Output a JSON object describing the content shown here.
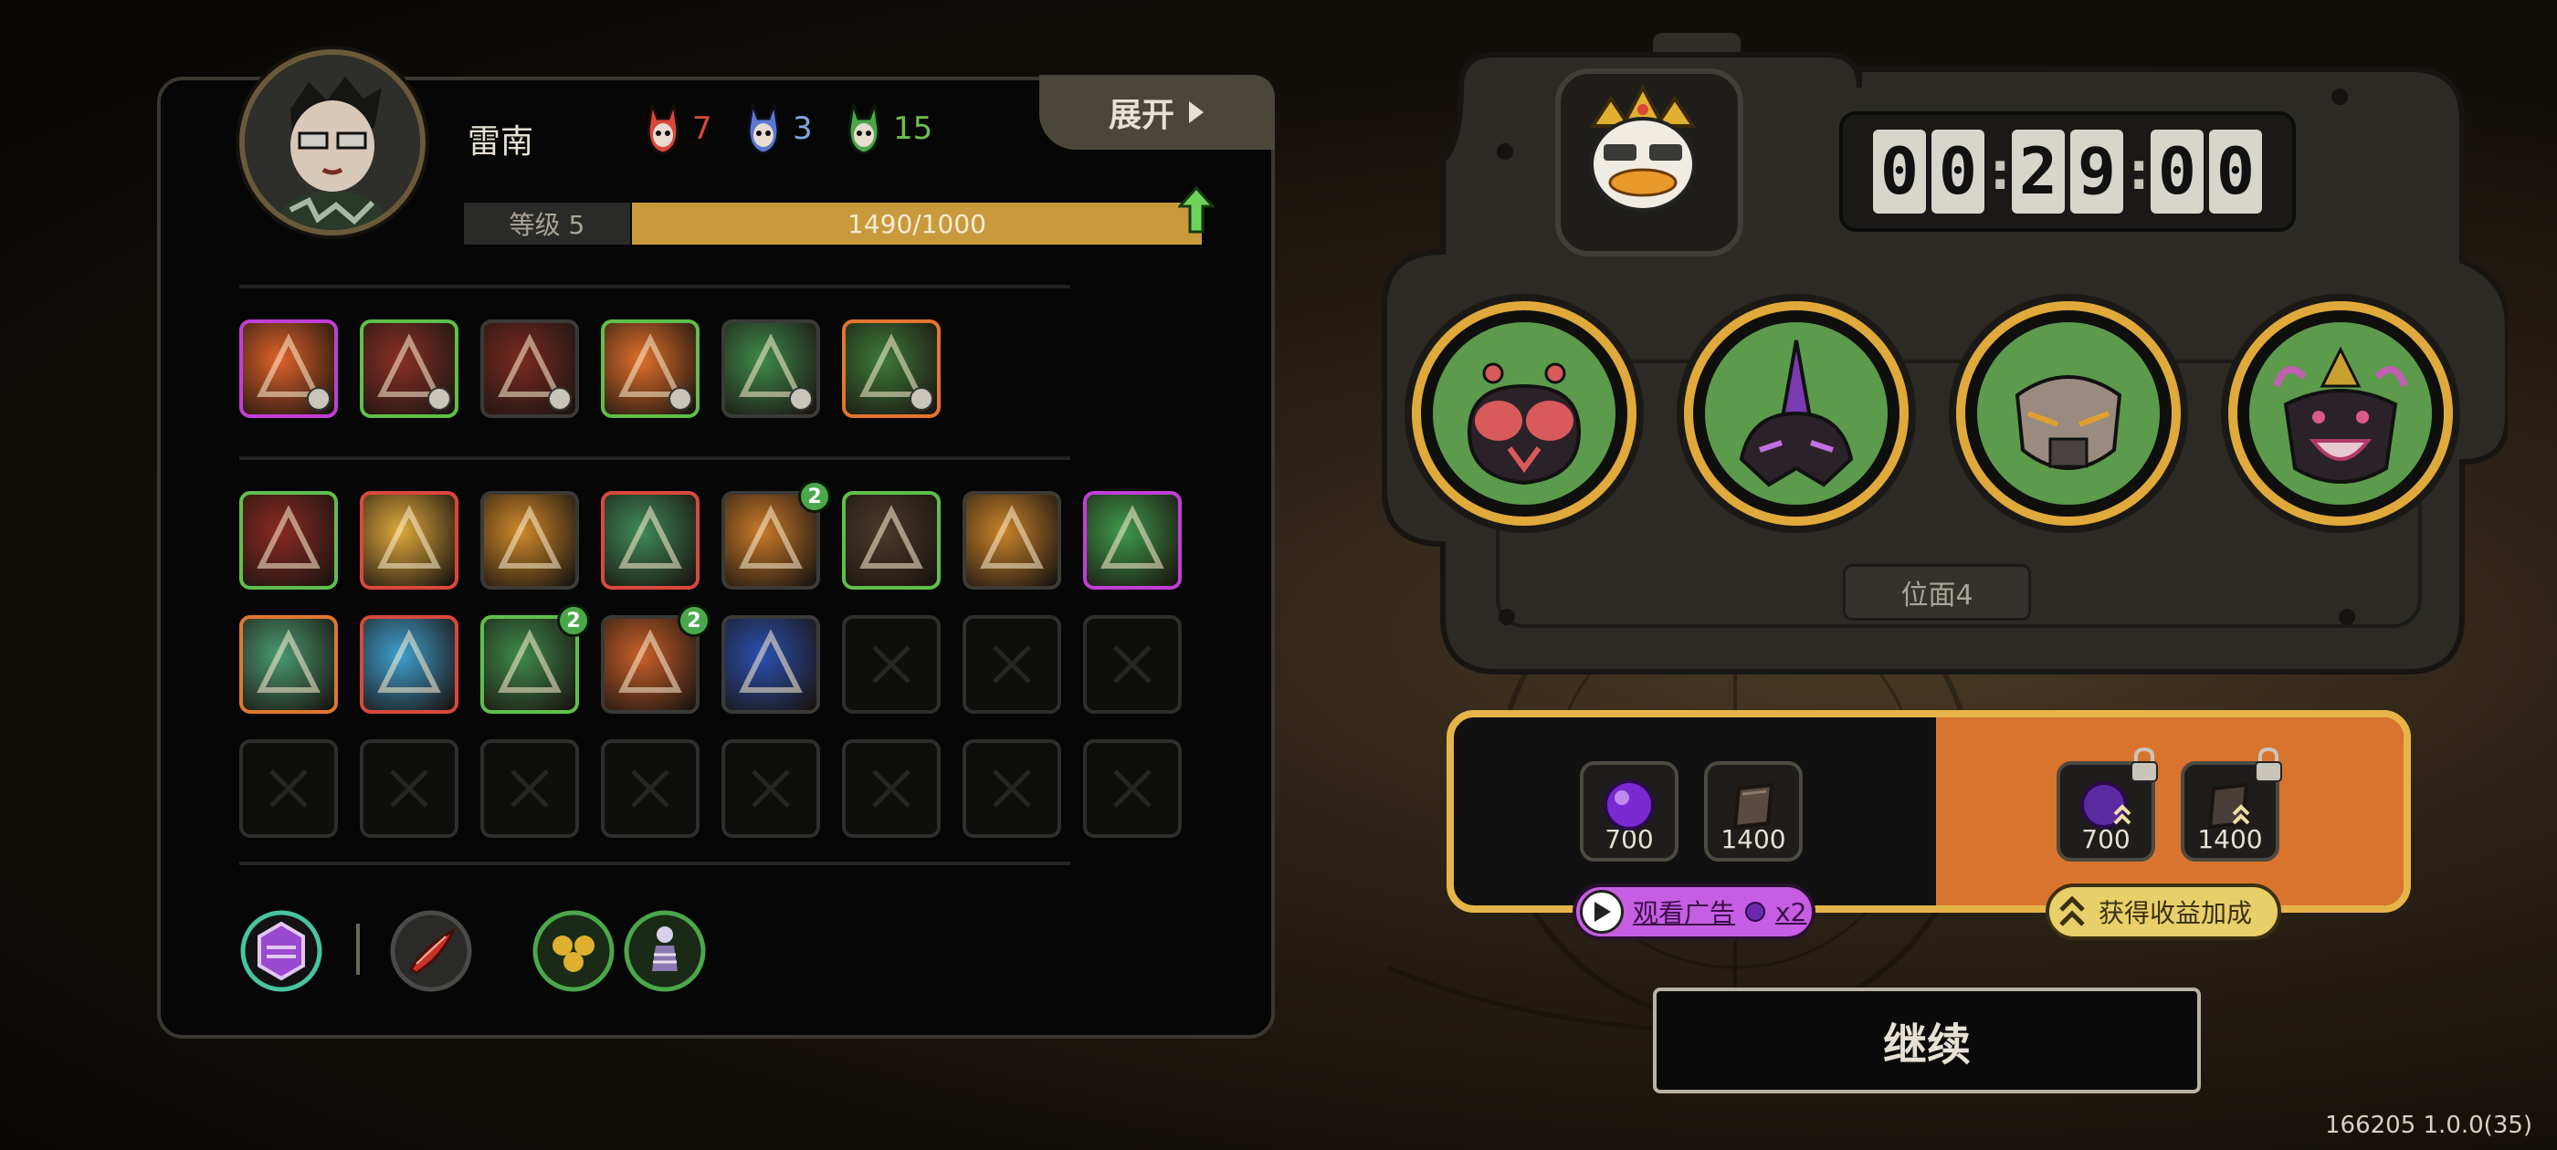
{
  "player": {
    "name": "雷南",
    "level_label": "等级 5",
    "exp_text": "1490/1000",
    "exp_fraction": 1.0,
    "masks": [
      {
        "name": "red-mask",
        "count": "7",
        "color": "#d9483b"
      },
      {
        "name": "blue-mask",
        "count": "3",
        "color": "#7fa6e0"
      },
      {
        "name": "green-mask",
        "count": "15",
        "color": "#6cc04a"
      }
    ]
  },
  "expand_button": {
    "label": "展开"
  },
  "equipped_skills": [
    {
      "name": "burst-skill",
      "border": "#c13ed6",
      "bg": "#e0622a"
    },
    {
      "name": "disc-skill",
      "border": "#5fbf4a",
      "bg": "#8a3028"
    },
    {
      "name": "claw-skill",
      "border": "#3a3a36",
      "bg": "#7a2a22"
    },
    {
      "name": "flame-skill",
      "border": "#5fbf4a",
      "bg": "#e0702a"
    },
    {
      "name": "crystal-skill",
      "border": "#3a3a36",
      "bg": "#3f8a4c"
    },
    {
      "name": "heart-skill",
      "border": "#e2762e",
      "bg": "#3e7a3a"
    }
  ],
  "inventory": [
    {
      "name": "slash-relic",
      "border": "#5fbf4a",
      "bg": "#8a2a24",
      "badge": ""
    },
    {
      "name": "spike-relic",
      "border": "#d9483b",
      "bg": "#e0a93c",
      "badge": ""
    },
    {
      "name": "sun-relic",
      "border": "#3a3a36",
      "bg": "#d08a2a",
      "badge": ""
    },
    {
      "name": "blade-relic",
      "border": "#d9483b",
      "bg": "#3f8a58",
      "badge": ""
    },
    {
      "name": "bolt-relic",
      "border": "#3a3a36",
      "bg": "#c97a2a",
      "badge": "2"
    },
    {
      "name": "beast-relic",
      "border": "#5fbf4a",
      "bg": "#4a3a2a",
      "badge": ""
    },
    {
      "name": "cog-relic",
      "border": "#3a3a36",
      "bg": "#c9832a",
      "badge": ""
    },
    {
      "name": "wind-relic",
      "border": "#c13ed6",
      "bg": "#3f9a4c",
      "badge": ""
    },
    {
      "name": "chain-relic",
      "border": "#e2762e",
      "bg": "#4a9a72",
      "badge": ""
    },
    {
      "name": "star-relic",
      "border": "#d9483b",
      "bg": "#3fa0d0",
      "badge": ""
    },
    {
      "name": "leaf-relic",
      "border": "#5fbf4a",
      "bg": "#3f8a4c",
      "badge": "2"
    },
    {
      "name": "wing-relic",
      "border": "#3a3a36",
      "bg": "#c9602a",
      "badge": "2"
    },
    {
      "name": "storm-relic",
      "border": "#3a3a36",
      "bg": "#2a50b0",
      "badge": ""
    }
  ],
  "empty_slot_count": 11,
  "bottom_icons": [
    {
      "name": "purple-gem-icon",
      "ring": "#47c4a0",
      "fill": "#9a4ad0"
    },
    {
      "name": "red-feather-icon",
      "ring": "#4a4a46",
      "fill": "#c9322a"
    },
    {
      "name": "golden-orbs-icon",
      "ring": "#4aa84a",
      "fill": "#e0b030"
    },
    {
      "name": "pawn-icon",
      "ring": "#4aa84a",
      "fill": "#8a7ab0"
    }
  ],
  "timer": {
    "digits": [
      "0",
      "0",
      "2",
      "9",
      "0",
      "0"
    ]
  },
  "plane_label": "位面4",
  "bosses": [
    {
      "name": "fly-boss",
      "color": "#d95a5a"
    },
    {
      "name": "horn-boss",
      "color": "#7a3ab0"
    },
    {
      "name": "mecha-boss",
      "color": "#9a8a80"
    },
    {
      "name": "jaw-boss",
      "color": "#b03a6a"
    }
  ],
  "rewards": {
    "free": [
      {
        "name": "purple-orb-reward",
        "amount": "700"
      },
      {
        "name": "book-reward",
        "amount": "1400"
      }
    ],
    "bonus": [
      {
        "name": "purple-orb-bonus",
        "amount": "700"
      },
      {
        "name": "book-bonus",
        "amount": "1400"
      }
    ]
  },
  "ad_button": {
    "label": "观看广告",
    "multiplier": "x2"
  },
  "bonus_button": {
    "label": "获得收益加成"
  },
  "continue_button": {
    "label": "继续"
  },
  "version": "166205 1.0.0(35)",
  "colors": {
    "gold": "#e0a93c",
    "orange_panel": "#d9742f",
    "purple_button": "#c65ee3"
  }
}
